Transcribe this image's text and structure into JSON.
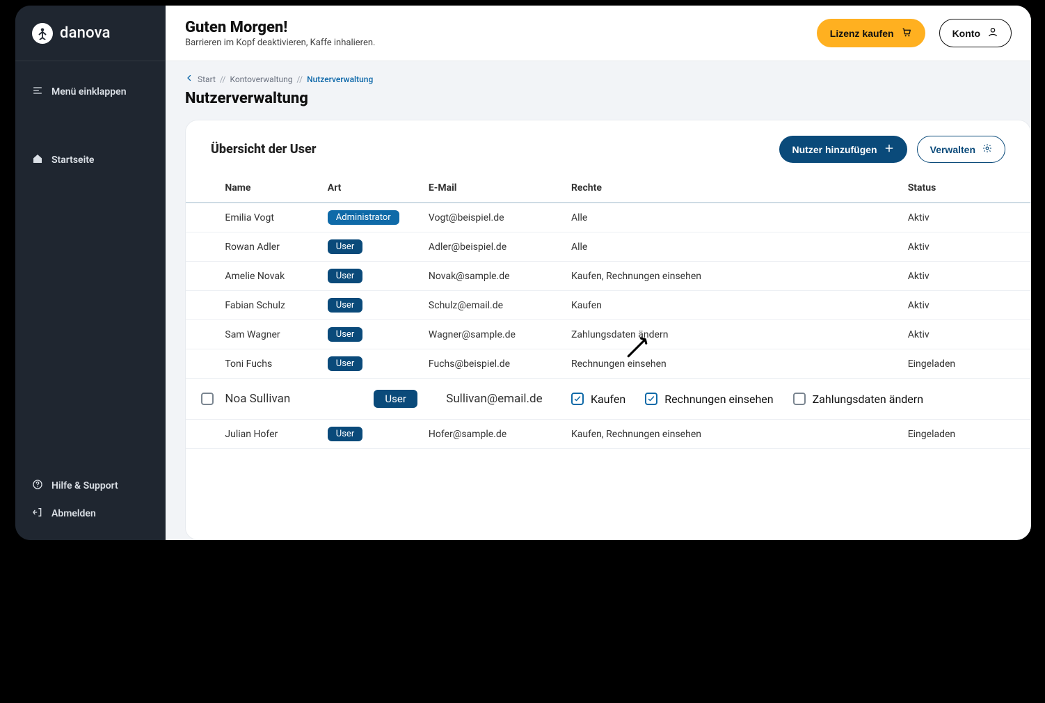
{
  "brand": {
    "name": "danova"
  },
  "sidebar": {
    "collapse_label": "Menü einklappen",
    "home_label": "Startseite",
    "help_label": "Hilfe & Support",
    "logout_label": "Abmelden"
  },
  "topbar": {
    "greeting_title": "Guten Morgen!",
    "greeting_sub": "Barrieren im Kopf deaktivieren, Kaffe inhalieren.",
    "license_btn": "Lizenz kaufen",
    "account_btn": "Konto"
  },
  "breadcrumbs": {
    "root": "Start",
    "level1": "Kontoverwaltung",
    "current": "Nutzerverwaltung",
    "sep": " // "
  },
  "page": {
    "title": "Nutzerverwaltung"
  },
  "card": {
    "title": "Übersicht der User",
    "add_btn": "Nutzer hinzufügen",
    "manage_btn": "Verwalten"
  },
  "table": {
    "head": {
      "name": "Name",
      "type": "Art",
      "email": "E-Mail",
      "rights": "Rechte",
      "status": "Status"
    },
    "type_labels": {
      "admin": "Administrator",
      "user": "User"
    },
    "rows": [
      {
        "name": "Emilia Vogt",
        "type": "admin",
        "email": "Vogt@beispiel.de",
        "rights": "Alle",
        "status": "Aktiv"
      },
      {
        "name": "Rowan Adler",
        "type": "user",
        "email": "Adler@beispiel.de",
        "rights": "Alle",
        "status": "Aktiv"
      },
      {
        "name": "Amelie Novak",
        "type": "user",
        "email": "Novak@sample.de",
        "rights": "Kaufen, Rechnungen einsehen",
        "status": "Aktiv"
      },
      {
        "name": "Fabian Schulz",
        "type": "user",
        "email": "Schulz@email.de",
        "rights": "Kaufen",
        "status": "Aktiv"
      },
      {
        "name": "Sam Wagner",
        "type": "user",
        "email": "Wagner@sample.de",
        "rights": "Zahlungsdaten ändern",
        "status": "Aktiv"
      },
      {
        "name": "Toni Fuchs",
        "type": "user",
        "email": "Fuchs@beispiel.de",
        "rights": "Rechnungen einsehen",
        "status": "Eingeladen"
      }
    ],
    "edit_row": {
      "name": "Noa Sullivan",
      "type": "user",
      "email": "Sullivan@email.de",
      "rights": {
        "buy": {
          "label": "Kaufen",
          "checked": true
        },
        "invoices": {
          "label": "Rechnungen einsehen",
          "checked": true
        },
        "payment": {
          "label": "Zahlungsdaten ändern",
          "checked": false
        }
      }
    },
    "tail_row": {
      "name": "Julian Hofer",
      "type": "user",
      "email": "Hofer@sample.de",
      "rights": "Kaufen, Rechnungen einsehen",
      "status": "Eingeladen"
    }
  }
}
